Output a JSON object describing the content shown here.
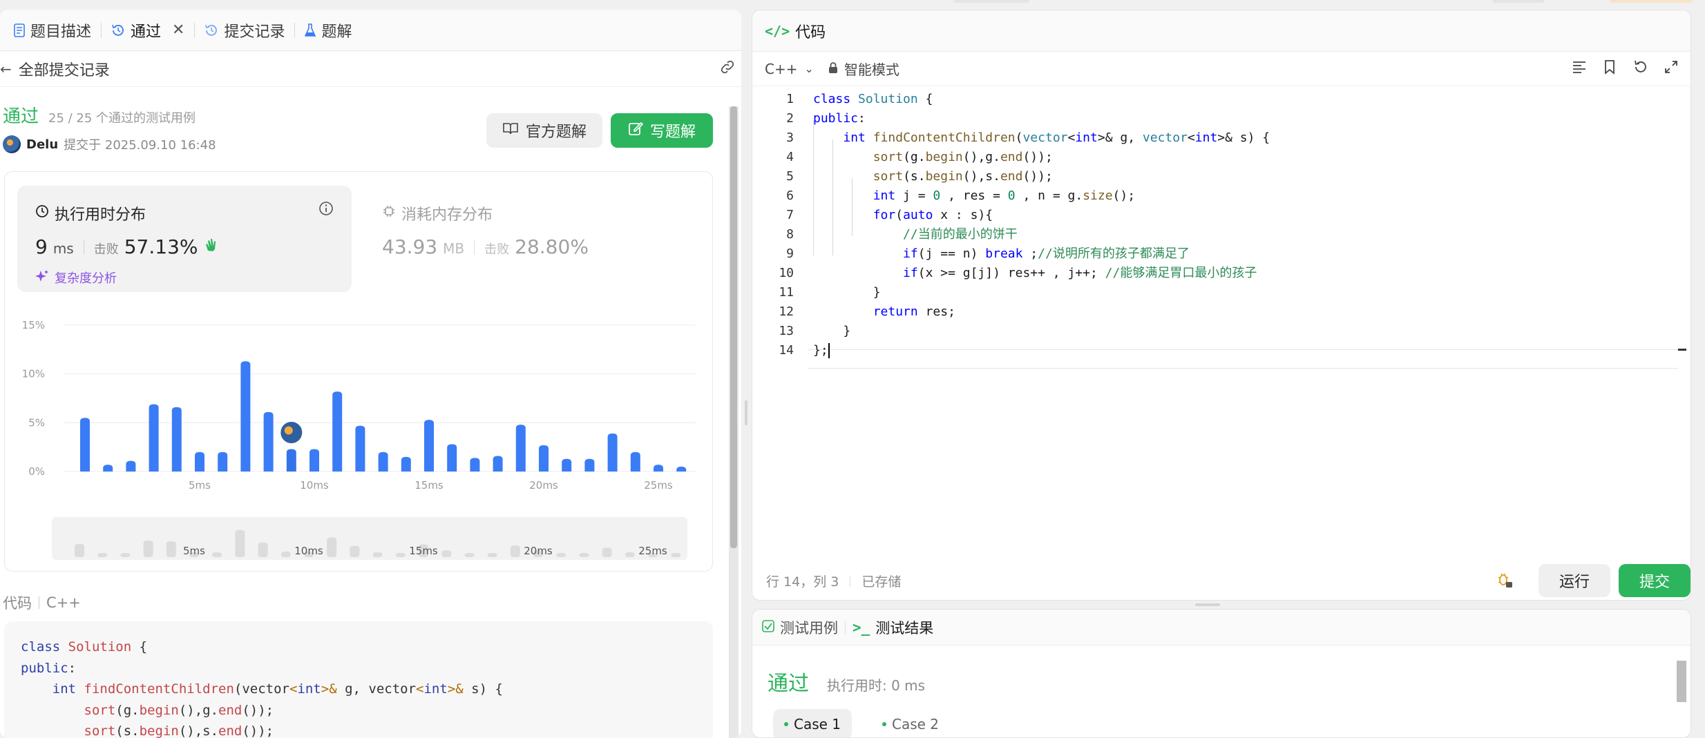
{
  "tabs": [
    {
      "label": "题目描述",
      "icon": "document-icon"
    },
    {
      "label": "通过",
      "icon": "history-icon",
      "active": true
    },
    {
      "label": "提交记录",
      "icon": "history-icon"
    },
    {
      "label": "题解",
      "icon": "flask-icon"
    }
  ],
  "subbar": {
    "back_label": "全部提交记录"
  },
  "result": {
    "status": "通过",
    "cases": "25 / 25 个通过的测试用例",
    "author": "Delu",
    "submitted": "提交于 2025.09.10 16:48"
  },
  "buttons": {
    "official": "官方题解",
    "write": "写题解"
  },
  "runtime": {
    "title": "执行用时分布",
    "value": "9",
    "unit": "ms",
    "beat_label": "击败",
    "beat_pct": "57.13%",
    "complexity": "复杂度分析"
  },
  "memory": {
    "title": "消耗内存分布",
    "value": "43.93",
    "unit": "MB",
    "beat_label": "击败",
    "beat_pct": "28.80%"
  },
  "chart_data": {
    "type": "bar",
    "title": "",
    "xlabel": "",
    "ylabel": "",
    "y_ticks": [
      "15%",
      "10%",
      "5%",
      "0%"
    ],
    "ylim": [
      0,
      15
    ],
    "x_ticks": [
      {
        "label": "5ms",
        "x": 5
      },
      {
        "label": "10ms",
        "x": 10
      },
      {
        "label": "15ms",
        "x": 15
      },
      {
        "label": "20ms",
        "x": 20
      },
      {
        "label": "25ms",
        "x": 25
      }
    ],
    "x": [
      0,
      1,
      2,
      3,
      4,
      5,
      6,
      7,
      8,
      9,
      10,
      11,
      12,
      13,
      14,
      15,
      16,
      17,
      18,
      19,
      20,
      21,
      22,
      23,
      24,
      25,
      26,
      27
    ],
    "values": [
      5.5,
      0.7,
      1.1,
      6.9,
      6.6,
      2.0,
      2.0,
      11.3,
      6.1,
      2.3,
      2.3,
      8.2,
      4.7,
      2.0,
      1.5,
      5.3,
      2.8,
      1.4,
      1.6,
      4.8,
      2.7,
      1.3,
      1.3,
      3.9,
      2.0,
      0.7,
      0.5,
      0
    ],
    "highlight_x": 9,
    "grid": true
  },
  "overview_ticks": [
    "5ms",
    "10ms",
    "15ms",
    "20ms",
    "25ms"
  ],
  "code_section": {
    "label": "代码",
    "lang": "C++"
  },
  "editor": {
    "title": "代码",
    "lang": "C++",
    "mode": "智能模式",
    "status_pos": "行 14，列 3",
    "status_saved": "已存储",
    "run": "运行",
    "submit": "提交"
  },
  "code_lines": [
    {
      "n": "1",
      "text": "class Solution {"
    },
    {
      "n": "2",
      "text": "public:"
    },
    {
      "n": "3",
      "text": "    int findContentChildren(vector<int>& g, vector<int>& s) {"
    },
    {
      "n": "4",
      "text": "        sort(g.begin(),g.end());"
    },
    {
      "n": "5",
      "text": "        sort(s.begin(),s.end());"
    },
    {
      "n": "6",
      "text": "        int j = 0 , res = 0 , n = g.size();"
    },
    {
      "n": "7",
      "text": "        for(auto x : s){"
    },
    {
      "n": "8",
      "text": "            //当前的最小的饼干"
    },
    {
      "n": "9",
      "text": "            if(j == n) break ;//说明所有的孩子都满足了"
    },
    {
      "n": "10",
      "text": "            if(x >= g[j]) res++ , j++; //能够满足胃口最小的孩子"
    },
    {
      "n": "11",
      "text": "        }"
    },
    {
      "n": "12",
      "text": "        return res;"
    },
    {
      "n": "13",
      "text": "    }"
    },
    {
      "n": "14",
      "text": "};"
    }
  ],
  "test_panel": {
    "tab_cases": "测试用例",
    "tab_result": "测试结果",
    "status": "通过",
    "runtime": "执行用时: 0 ms",
    "cases": [
      "Case 1",
      "Case 2"
    ]
  },
  "colors": {
    "accent_green": "#2db55d",
    "bar_blue": "#3a7cf6",
    "purple": "#8a55e6"
  }
}
